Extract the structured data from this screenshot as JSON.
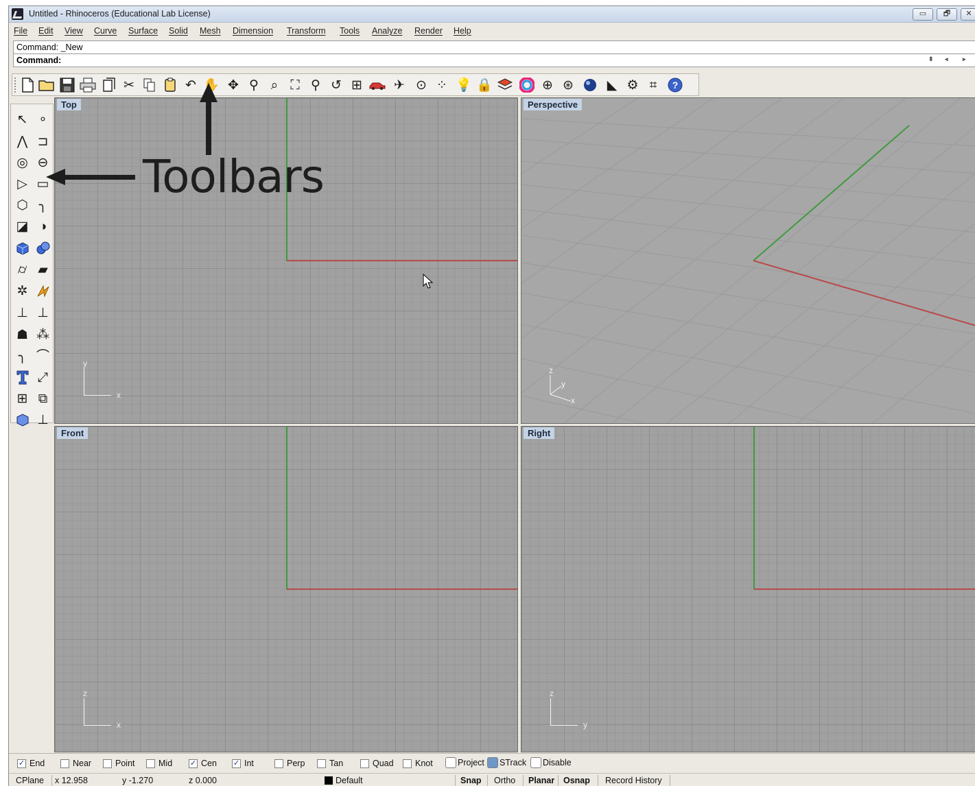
{
  "window": {
    "title": "Untitled - Rhinoceros (Educational Lab License)",
    "controls": {
      "minimize": "▭",
      "restore": "🗗",
      "close": "✕"
    }
  },
  "menu": [
    "File",
    "Edit",
    "View",
    "Curve",
    "Surface",
    "Solid",
    "Mesh",
    "Dimension",
    "Transform",
    "Tools",
    "Analyze",
    "Render",
    "Help"
  ],
  "command": {
    "history": "Command: _New",
    "prompt": "Command:",
    "spin_up_down": "⬍",
    "scroll_left": "◂",
    "scroll_right": "▸"
  },
  "toolbar_icons": [
    "new-icon",
    "open-icon",
    "save-icon",
    "print-icon",
    "import-icon",
    "cut-icon",
    "copy-icon",
    "paste-icon",
    "undo-icon",
    "pan-icon",
    "rotate-view-icon",
    "zoom-dynamic-icon",
    "zoom-window-icon",
    "zoom-extents-icon",
    "zoom-selected-icon",
    "undo-view-icon",
    "viewport-layout-icon",
    "car-icon",
    "plane-icon",
    "circle-point-icon",
    "scatter-icon",
    "light-icon",
    "lock-icon",
    "layer-icon",
    "color-wheel-icon",
    "sphere-wire-icon",
    "sphere-shade-icon",
    "render-icon",
    "lasso-icon",
    "gear-icon",
    "dimension-icon",
    "help-icon"
  ],
  "annotation": {
    "label": "Toolbars"
  },
  "viewports": {
    "top": "Top",
    "perspective": "Perspective",
    "front": "Front",
    "right": "Right"
  },
  "axis_labels": {
    "top": {
      "h": "x",
      "v": "y"
    },
    "perspective": {
      "x": "x",
      "y": "y",
      "z": "z"
    },
    "front": {
      "h": "x",
      "v": "z"
    },
    "right": {
      "h": "y",
      "v": "z"
    }
  },
  "osnaps": [
    {
      "label": "End",
      "checked": true
    },
    {
      "label": "Near",
      "checked": false
    },
    {
      "label": "Point",
      "checked": false
    },
    {
      "label": "Mid",
      "checked": false
    },
    {
      "label": "Cen",
      "checked": true
    },
    {
      "label": "Int",
      "checked": true
    },
    {
      "label": "Perp",
      "checked": false
    },
    {
      "label": "Tan",
      "checked": false
    },
    {
      "label": "Quad",
      "checked": false
    },
    {
      "label": "Knot",
      "checked": false
    }
  ],
  "osnap_toggles": {
    "project": "Project",
    "strack": "STrack",
    "disable": "Disable"
  },
  "status": {
    "cplane": "CPlane",
    "x": "x 12.958",
    "y": "y -1.270",
    "z": "z 0.000",
    "layer": "Default",
    "snap": "Snap",
    "ortho": "Ortho",
    "planar": "Planar",
    "osnap": "Osnap",
    "record_history": "Record History"
  },
  "colors": {
    "x_axis": "#b94a4a",
    "y_axis": "#3f9a3f",
    "viewport_label": "#c4d3e6",
    "viewport_bg": "#a1a1a1"
  }
}
